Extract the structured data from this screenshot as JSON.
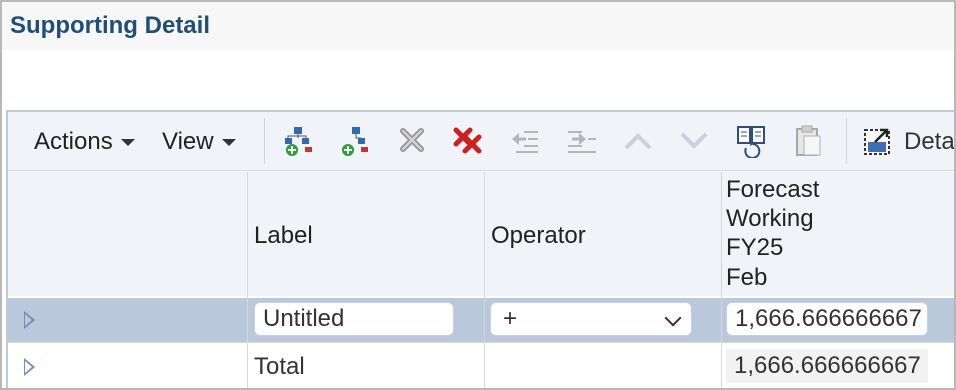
{
  "header": {
    "title": "Supporting Detail"
  },
  "toolbar": {
    "actions_label": "Actions",
    "view_label": "View",
    "detail_label": "Deta",
    "icons": [
      "add-child-icon",
      "add-sibling-icon",
      "delete-icon",
      "delete-all-icon",
      "promote-icon",
      "demote-icon",
      "move-up-icon",
      "move-down-icon",
      "duplicate-row-icon",
      "paste-icon",
      "detail-view-icon"
    ]
  },
  "grid": {
    "columns": {
      "label": "Label",
      "operator": "Operator",
      "forecast_lines": [
        "Forecast",
        "Working",
        "FY25",
        "Feb"
      ]
    },
    "rows": [
      {
        "label": "Untitled",
        "operator": "+",
        "value": "1,666.666666667"
      },
      {
        "label": "Total",
        "operator": "",
        "value": "1,666.666666667"
      }
    ]
  },
  "colors": {
    "title": "#1f4e79",
    "selected_row": "#b9c8db",
    "header_bg": "#f0f3f8"
  }
}
